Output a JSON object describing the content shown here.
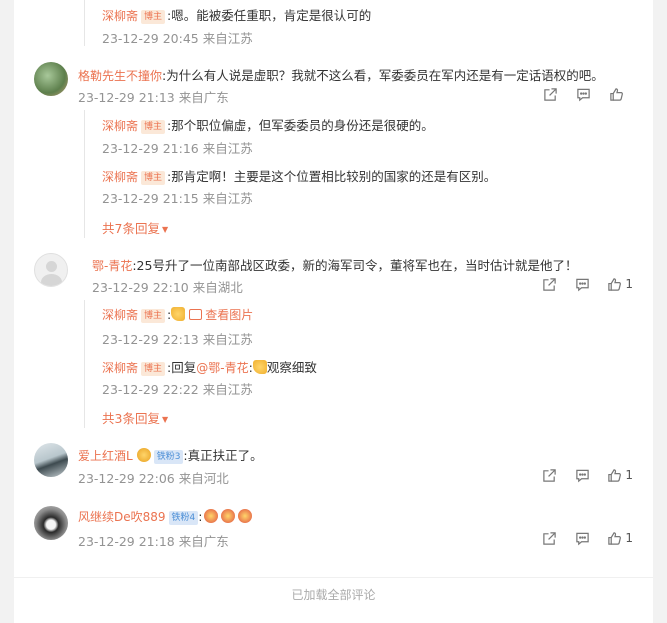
{
  "comments": [
    {
      "author": "格勒先生不撞你",
      "text": ":为什么有人说是虚职？我就不这么看，军委委员在军内还是有一定话语权的吧。",
      "time": "23-12-29 21:13 来自广东",
      "likes": ""
    },
    {
      "author": "鄂-青花",
      "text": ":25号升了一位南部战区政委，新的海军司令，董将军也在，当时估计就是他了！",
      "time": "23-12-29 22:10 来自湖北",
      "likes": "1"
    },
    {
      "author": "爱上红酒L",
      "fan_badge": "铁粉3",
      "text": ":真正扶正了。",
      "time": "23-12-29 22:06 来自河北",
      "likes": "1"
    },
    {
      "author": "风继续De吹889",
      "fan_badge": "铁粉4",
      "text": ":",
      "time": "23-12-29 21:18 来自广东",
      "likes": "1"
    }
  ],
  "replies": {
    "top": {
      "author": "深柳斋",
      "tag": "博主",
      "text": ":嗯。能被委任重职，肯定是很认可的",
      "time": "23-12-29 20:45 来自江苏"
    },
    "c1": [
      {
        "author": "深柳斋",
        "tag": "博主",
        "text": ":那个职位偏虚，但军委委员的身份还是很硬的。",
        "time": "23-12-29 21:16 来自江苏"
      },
      {
        "author": "深柳斋",
        "tag": "博主",
        "text": ":那肯定啊！主要是这个位置相比较别的国家的还是有区别。",
        "time": "23-12-29 21:15 来自江苏"
      }
    ],
    "c1_more": "共7条回复",
    "c2": [
      {
        "author": "深柳斋",
        "tag": "博主",
        "text": ":",
        "link": "查看图片",
        "time": "23-12-29 22:13 来自江苏"
      },
      {
        "author": "深柳斋",
        "tag": "博主",
        "text_before": ":回复",
        "mention": "@鄂-青花",
        "text_after": ":",
        "text_end": "观察细致",
        "time": "23-12-29 22:22 来自江苏"
      }
    ],
    "c2_more": "共3条回复"
  },
  "footer": "已加载全部评论",
  "colors": {
    "accent": "#eb7350",
    "meta": "#939393",
    "background": "#f2f2f2"
  },
  "icons": [
    "share-icon",
    "comment-icon",
    "like-icon",
    "image-icon",
    "chevron-down-icon",
    "thumbs-up-emoji",
    "face-emoji"
  ]
}
